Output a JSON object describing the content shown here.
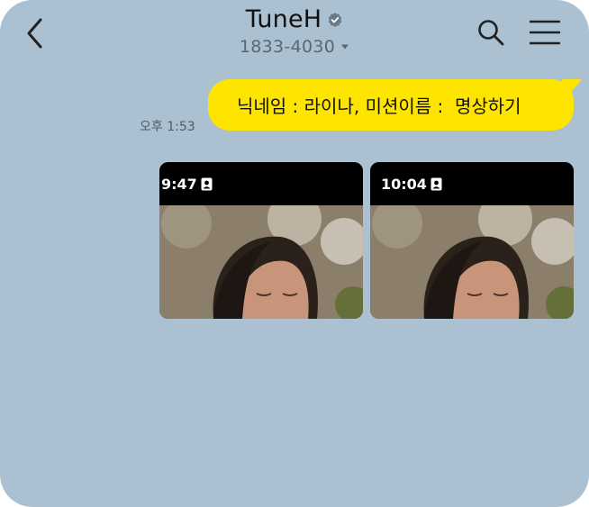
{
  "header": {
    "title": "TuneH",
    "phone": "1833-4030",
    "icons": {
      "back": "chevron-left-icon",
      "verified": "verified-badge-icon",
      "dropdown": "caret-down-icon",
      "search": "search-icon",
      "menu": "hamburger-menu-icon"
    }
  },
  "chat": {
    "messages": [
      {
        "text": "닉네임 : 라이나, 미션이름 :  명상하기",
        "time": "오후 1:53",
        "sender": "me"
      }
    ],
    "attachments": [
      {
        "status_time": "9:47"
      },
      {
        "status_time": "10:04"
      }
    ]
  },
  "colors": {
    "background": "#abc1d1",
    "bubble": "#fee500",
    "text": "#111111",
    "meta": "#4f5b66"
  }
}
